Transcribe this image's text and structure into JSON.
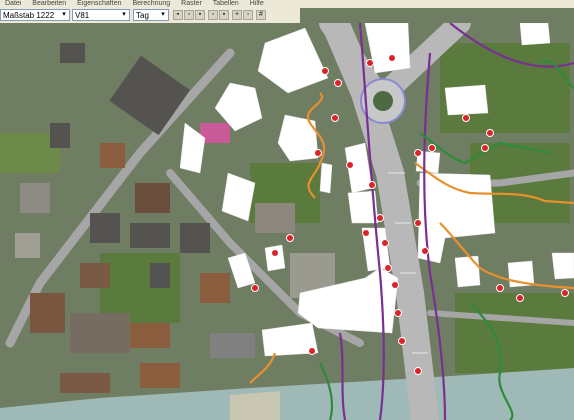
{
  "menu": [
    "Datei",
    "Bearbeiten",
    "Eigenschaften",
    "Berechnung",
    "Raster",
    "Tabellen",
    "Hilfe"
  ],
  "toolbar": {
    "scale_value": "Maßstab  1222",
    "layer_value": "V81",
    "mode_value": "Tag",
    "icons": [
      "save-icon",
      "folder-icon",
      "print-icon",
      "copy-icon",
      "paste-icon",
      "zoom-icon",
      "select-icon",
      "grid-icon"
    ]
  },
  "palette": {
    "icons": [
      "pointer-icon",
      "zoom-in-icon",
      "zoom-out-icon",
      "pan-icon",
      "arrow-icon",
      "line-icon",
      "polyline-icon",
      "rectangle-icon",
      "circle-icon",
      "text-icon",
      "pen-icon",
      "fill-icon",
      "measure-icon",
      "layer-icon",
      "point-icon",
      "node-icon",
      "edit-icon",
      "move-icon",
      "rotate-icon",
      "scale-icon",
      "delete-icon",
      "info-icon",
      "grid-icon",
      "snap-icon",
      "table-icon",
      "chart-icon",
      "print-icon",
      "export-icon"
    ]
  },
  "colors": {
    "contour_orange": "#e8902c",
    "contour_purple": "#7a2f93",
    "contour_green": "#2f8a3c",
    "building_highlight": "#ffffff",
    "road": "#b8b8b8",
    "river": "#9fb9b6",
    "marker_red": "#d9242a"
  }
}
